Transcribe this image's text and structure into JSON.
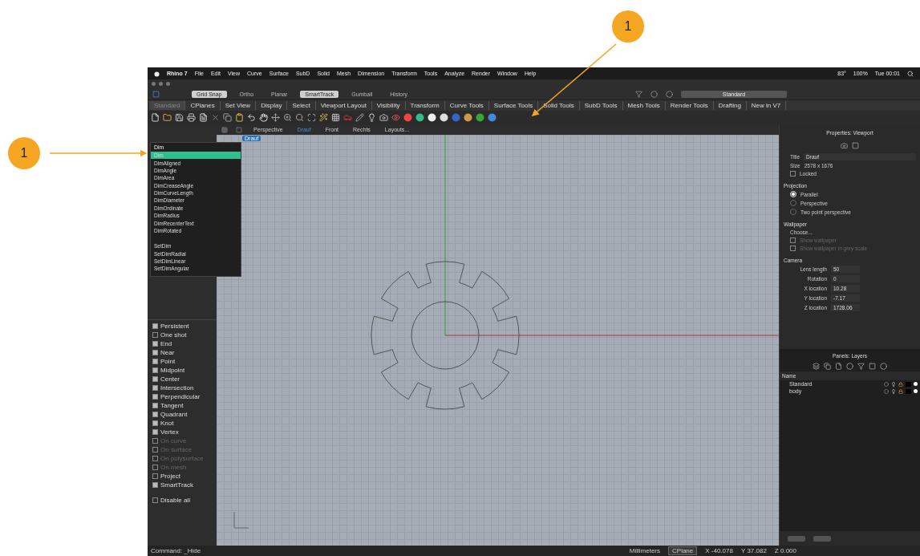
{
  "menubar": {
    "app": "Rhino 7",
    "items": [
      "File",
      "Edit",
      "View",
      "Curve",
      "Surface",
      "SubD",
      "Solid",
      "Mesh",
      "Dimension",
      "Transform",
      "Tools",
      "Analyze",
      "Render",
      "Window",
      "Help"
    ],
    "status_items": [
      "83°",
      "100%",
      "Tue 00:01"
    ]
  },
  "osnap_toggles": [
    {
      "label": "Grid Snap",
      "on": true
    },
    {
      "label": "Ortho",
      "on": false
    },
    {
      "label": "Planar",
      "on": false
    },
    {
      "label": "SmartTrack",
      "on": true
    },
    {
      "label": "Gumball",
      "on": false
    },
    {
      "label": "History",
      "on": false
    }
  ],
  "display_mode": "Standard",
  "toolbar_tabs": [
    {
      "label": "Standard",
      "selected": true
    },
    {
      "label": "CPlanes",
      "selected": false
    },
    {
      "label": "Set View",
      "selected": false
    },
    {
      "label": "Display",
      "selected": false
    },
    {
      "label": "Select",
      "selected": false
    },
    {
      "label": "Viewport Layout",
      "selected": false
    },
    {
      "label": "Visibility",
      "selected": false
    },
    {
      "label": "Transform",
      "selected": false
    },
    {
      "label": "Curve Tools",
      "selected": false
    },
    {
      "label": "Surface Tools",
      "selected": false
    },
    {
      "label": "Solid Tools",
      "selected": false
    },
    {
      "label": "SubD Tools",
      "selected": false
    },
    {
      "label": "Mesh Tools",
      "selected": false
    },
    {
      "label": "Render Tools",
      "selected": false
    },
    {
      "label": "Drafting",
      "selected": false
    },
    {
      "label": "New in V7",
      "selected": false
    }
  ],
  "viewport_tabs": [
    {
      "label": "Perspective",
      "selected": false
    },
    {
      "label": "Drauf",
      "selected": true
    },
    {
      "label": "Front",
      "selected": false
    },
    {
      "label": "Rechts",
      "selected": false
    },
    {
      "label": "Layouts...",
      "selected": false
    }
  ],
  "viewport": {
    "label": "Drauf"
  },
  "command_menu": {
    "value": "Dim",
    "groups": [
      [
        {
          "label": "Dim",
          "selected": true
        },
        {
          "label": "DimAligned",
          "selected": false
        },
        {
          "label": "DimAngle",
          "selected": false
        },
        {
          "label": "DimArea",
          "selected": false
        },
        {
          "label": "DimCreaseAngle",
          "selected": false
        },
        {
          "label": "DimCurveLength",
          "selected": false
        },
        {
          "label": "DimDiameter",
          "selected": false
        },
        {
          "label": "DimOrdinate",
          "selected": false
        },
        {
          "label": "DimRadius",
          "selected": false
        },
        {
          "label": "DimRecenterText",
          "selected": false
        },
        {
          "label": "DimRotated",
          "selected": false
        }
      ],
      [
        {
          "label": "SetDim",
          "selected": false
        },
        {
          "label": "SetDimRadial",
          "selected": false
        },
        {
          "label": "SetDimLinear",
          "selected": false
        },
        {
          "label": "SetDimAngular",
          "selected": false
        }
      ]
    ]
  },
  "osnaps": [
    {
      "label": "Persistent",
      "checked": true,
      "disabled": false
    },
    {
      "label": "One shot",
      "checked": false,
      "disabled": false
    },
    {
      "label": "End",
      "checked": true,
      "disabled": false
    },
    {
      "label": "Near",
      "checked": true,
      "disabled": false
    },
    {
      "label": "Point",
      "checked": true,
      "disabled": false
    },
    {
      "label": "Midpoint",
      "checked": true,
      "disabled": false
    },
    {
      "label": "Center",
      "checked": true,
      "disabled": false
    },
    {
      "label": "Intersection",
      "checked": true,
      "disabled": false
    },
    {
      "label": "Perpendicular",
      "checked": true,
      "disabled": false
    },
    {
      "label": "Tangent",
      "checked": true,
      "disabled": false
    },
    {
      "label": "Quadrant",
      "checked": true,
      "disabled": false
    },
    {
      "label": "Knot",
      "checked": true,
      "disabled": false
    },
    {
      "label": "Vertex",
      "checked": true,
      "disabled": false
    },
    {
      "label": "On curve",
      "checked": false,
      "disabled": true
    },
    {
      "label": "On surface",
      "checked": false,
      "disabled": true
    },
    {
      "label": "On polysurface",
      "checked": false,
      "disabled": true
    },
    {
      "label": "On mesh",
      "checked": false,
      "disabled": true
    },
    {
      "label": "Project",
      "checked": false,
      "disabled": false
    },
    {
      "label": "SmartTrack",
      "checked": true,
      "disabled": false
    },
    {
      "label": "Disable all",
      "checked": false,
      "disabled": false,
      "kind": "spaced"
    }
  ],
  "properties": {
    "title": "Properties: Viewport",
    "title_label": "Title",
    "title_value": "Drauf",
    "size_label": "Size",
    "size_value": "2578 x 1676",
    "locked": {
      "label": "Locked",
      "checked": false
    },
    "projection": {
      "heading": "Projection",
      "options": [
        {
          "label": "Parallel",
          "selected": true
        },
        {
          "label": "Perspective",
          "selected": false
        },
        {
          "label": "Two point perspective",
          "selected": false
        }
      ]
    },
    "wallpaper": {
      "heading": "Wallpaper",
      "choose": "Choose...",
      "options": [
        {
          "label": "Show wallpaper",
          "checked": false,
          "disabled": true
        },
        {
          "label": "Show wallpaper in grey scale",
          "checked": false,
          "disabled": true
        }
      ]
    },
    "camera": {
      "heading": "Camera",
      "fields": [
        {
          "label": "Lens length",
          "value": "50"
        },
        {
          "label": "Rotation",
          "value": "0"
        },
        {
          "label": "X location",
          "value": "10.28"
        },
        {
          "label": "Y location",
          "value": "-7.17"
        },
        {
          "label": "Z location",
          "value": "1728.06"
        }
      ]
    }
  },
  "layers": {
    "title": "Panels: Layers",
    "column": "Name",
    "rows": [
      {
        "name": "Standard",
        "color": "#000000"
      },
      {
        "name": "body",
        "color": "#000000"
      }
    ]
  },
  "status_bar": {
    "command": "Command: _Hide",
    "units": "Millimeters",
    "cplane": "CPlane",
    "x": "X -40.078",
    "y": "Y 37.082",
    "z": "Z 0.000"
  },
  "callouts": [
    {
      "label": "1"
    },
    {
      "label": "1"
    }
  ]
}
